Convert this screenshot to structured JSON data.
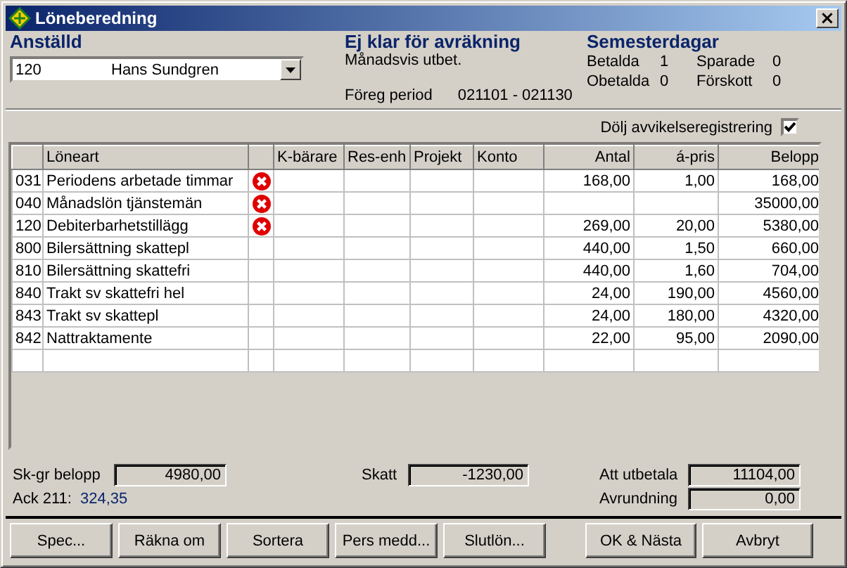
{
  "window": {
    "title": "Löneberedning",
    "close": "×"
  },
  "employee": {
    "label": "Anställd",
    "number": "120",
    "name": "Hans Sundgren"
  },
  "status": {
    "title": "Ej klar för avräkning",
    "payment": "Månadsvis utbet.",
    "period_label": "Föreg period",
    "period": "021101 - 021130"
  },
  "vacation": {
    "title": "Semesterdagar",
    "items": [
      {
        "label": "Betalda",
        "value": "1"
      },
      {
        "label": "Sparade",
        "value": "0"
      },
      {
        "label": "Obetalda",
        "value": "0"
      },
      {
        "label": "Förskott",
        "value": "0"
      }
    ]
  },
  "hide_deviation": {
    "label": "Dölj avvikelseregistrering",
    "checked": true
  },
  "table": {
    "columns": [
      "Löneart",
      "K-bärare",
      "Res-enh",
      "Projekt",
      "Konto",
      "Antal",
      "á-pris",
      "Belopp"
    ],
    "rows": [
      {
        "code": "031",
        "name": "Periodens arbetade timmar",
        "error": true,
        "antal": "168,00",
        "pris": "1,00",
        "belopp": "168,00"
      },
      {
        "code": "040",
        "name": "Månadslön tjänstemän",
        "error": true,
        "antal": "",
        "pris": "",
        "belopp": "35000,00"
      },
      {
        "code": "120",
        "name": "Debiterbarhetstillägg",
        "error": true,
        "antal": "269,00",
        "pris": "20,00",
        "belopp": "5380,00"
      },
      {
        "code": "800",
        "name": "Bilersättning skattepl",
        "error": false,
        "antal": "440,00",
        "pris": "1,50",
        "belopp": "660,00"
      },
      {
        "code": "810",
        "name": "Bilersättning skattefri",
        "error": false,
        "antal": "440,00",
        "pris": "1,60",
        "belopp": "704,00"
      },
      {
        "code": "840",
        "name": "Trakt sv skattefri hel",
        "error": false,
        "antal": "24,00",
        "pris": "190,00",
        "belopp": "4560,00"
      },
      {
        "code": "843",
        "name": "Trakt sv skattepl",
        "error": false,
        "antal": "24,00",
        "pris": "180,00",
        "belopp": "4320,00"
      },
      {
        "code": "842",
        "name": "Nattraktamente",
        "error": false,
        "antal": "22,00",
        "pris": "95,00",
        "belopp": "2090,00"
      }
    ]
  },
  "totals": {
    "skgr_label": "Sk-gr belopp",
    "skgr": "4980,00",
    "ack_label": "Ack 211:",
    "ack": "324,35",
    "skatt_label": "Skatt",
    "skatt": "-1230,00",
    "utbetala_label": "Att utbetala",
    "utbetala": "11104,00",
    "avrundning_label": "Avrundning",
    "avrundning": "0,00"
  },
  "buttons": [
    "Spec...",
    "Räkna om",
    "Sortera",
    "Pers medd...",
    "Slutlön...",
    "OK & Nästa",
    "Avbryt"
  ]
}
